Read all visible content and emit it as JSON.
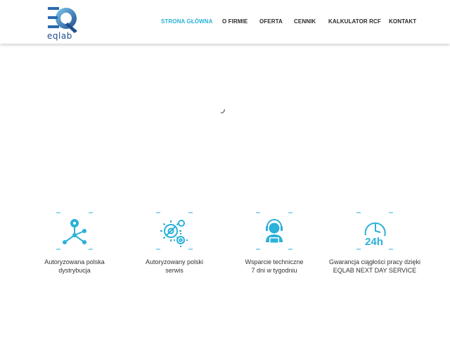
{
  "brand": {
    "logo_text": "eqlab",
    "accent_color": "#2bb1d8",
    "logo_color": "#1d4e8f"
  },
  "nav": {
    "items": [
      {
        "label": "STRONA GŁÓWNA",
        "active": true
      },
      {
        "label": "O FIRMIE",
        "active": false
      },
      {
        "label": "OFERTA",
        "active": false
      },
      {
        "label": "CENNIK",
        "active": false
      },
      {
        "label": "KALKULATOR RCF",
        "active": false
      },
      {
        "label": "KONTAKT",
        "active": false
      }
    ]
  },
  "features": [
    {
      "icon": "distribution-network-icon",
      "line1": "Autoryzowana polska",
      "line2": "dystrybucja"
    },
    {
      "icon": "gears-wrench-icon",
      "line1": "Autoryzowany polski",
      "line2": "serwis"
    },
    {
      "icon": "support-agent-icon",
      "line1": "Wsparcie techniczne",
      "line2": "7 dni w tygodniu"
    },
    {
      "icon": "clock-24h-icon",
      "line1": "Gwarancja ciągłości pracy dzięki",
      "line2": "EQLAB NEXT DAY SERVICE"
    }
  ]
}
